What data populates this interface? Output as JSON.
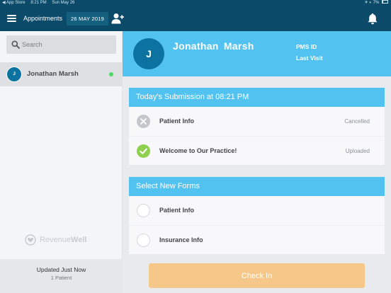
{
  "status_bar": {
    "back_app": "◀ App Store",
    "time": "8:21 PM",
    "date": "Sun May 26",
    "signal": "✈ ◐ 7%",
    "battery_level": 0.07
  },
  "navbar": {
    "title": "Appointments",
    "date": "26 MAY 2019",
    "icons": {
      "menu": "hamburger-icon",
      "add_user": "add-user-icon",
      "notifications": "bell-icon"
    }
  },
  "sidebar": {
    "search": {
      "placeholder": "Search",
      "value": ""
    },
    "patients": [
      {
        "initial": "J",
        "name": "Jonathan  Marsh",
        "online": true
      }
    ],
    "brand": {
      "name_light": "Revenue",
      "name_bold": "Well"
    },
    "footer": {
      "updated": "Updated Just Now",
      "count": "1 Patient"
    }
  },
  "patient_header": {
    "initial": "J",
    "name": "Jonathan  Marsh",
    "pms_id_label": "PMS ID",
    "last_visit_label": "Last Visit"
  },
  "submission": {
    "title": "Today's Submission at 08:21 PM",
    "items": [
      {
        "label": "Patient Info",
        "status": "Cancelled",
        "icon": "cancelled-x-icon"
      },
      {
        "label": "Welcome to Our Practice!",
        "status": "Uploaded",
        "icon": "uploaded-check-icon"
      }
    ]
  },
  "new_forms": {
    "title": "Select New Forms",
    "items": [
      {
        "label": "Patient Info",
        "selected": false
      },
      {
        "label": "Insurance Info",
        "selected": false
      }
    ]
  },
  "actions": {
    "check_in": "Check In"
  },
  "colors": {
    "navbar_bg": "#0c4a6a",
    "accent_blue": "#52c3f1",
    "avatar_blue": "#0c73a0",
    "online_green": "#4cd964",
    "success_green": "#8fd14f",
    "cancel_gray": "#c4c6cc",
    "checkin_orange": "#f5c889"
  }
}
